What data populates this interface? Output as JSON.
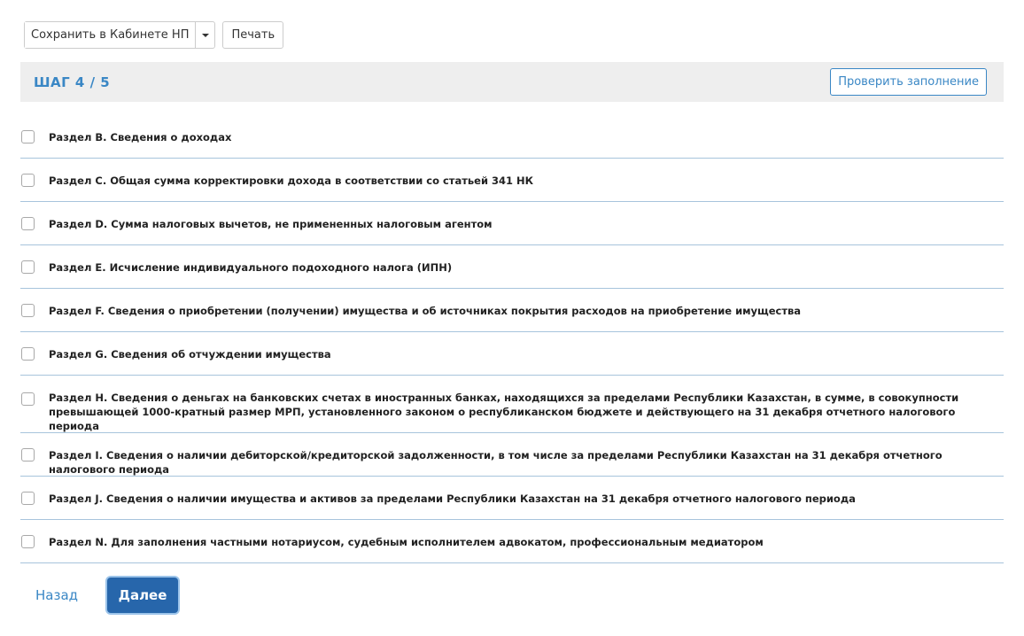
{
  "toolbar": {
    "save_label": "Сохранить в Кабинете НП",
    "print_label": "Печать"
  },
  "step": {
    "title": "ШАГ 4 / 5",
    "check_label": "Проверить заполнение"
  },
  "sections": [
    {
      "label": "Раздел B. Сведения о доходах",
      "checked": false
    },
    {
      "label": "Раздел C. Общая сумма корректировки дохода в соответствии со статьей 341 НК",
      "checked": false
    },
    {
      "label": "Раздел D. Сумма налоговых вычетов, не примененных налоговым агентом",
      "checked": false
    },
    {
      "label": "Раздел E. Исчисление индивидуального подоходного налога (ИПН)",
      "checked": false
    },
    {
      "label": "Раздел F. Сведения о приобретении (получении) имущества и об источниках покрытия расходов на приобретение имущества",
      "checked": false
    },
    {
      "label": "Раздел G. Сведения об отчуждении имущества",
      "checked": false
    },
    {
      "label": "Раздел H. Сведения о деньгах на банковских счетах в иностранных банках, находящихся за пределами Республики Казахстан, в сумме, в совокупности превышающей 1000-кратный размер МРП, установленного законом о республиканском бюджете и действующего на 31 декабря отчетного налогового периода",
      "checked": false
    },
    {
      "label": "Раздел I. Сведения о наличии дебиторской/кредиторской задолженности, в том числе за пределами Республики Казахстан на 31 декабря отчетного налогового периода",
      "checked": false
    },
    {
      "label": "Раздел J. Сведения о наличии имущества и активов за пределами Республики Казахстан на 31 декабря отчетного налогового периода",
      "checked": false
    },
    {
      "label": "Раздел N. Для заполнения частными нотариусом, судебным исполнителем адвокатом, профессиональным медиатором",
      "checked": false
    }
  ],
  "footer": {
    "back_label": "Назад",
    "next_label": "Далее"
  },
  "colors": {
    "accent": "#3a87c5",
    "primary_button": "#2766ab",
    "step_bar_bg": "#eeeeee",
    "row_divider": "#a7c4dc"
  }
}
